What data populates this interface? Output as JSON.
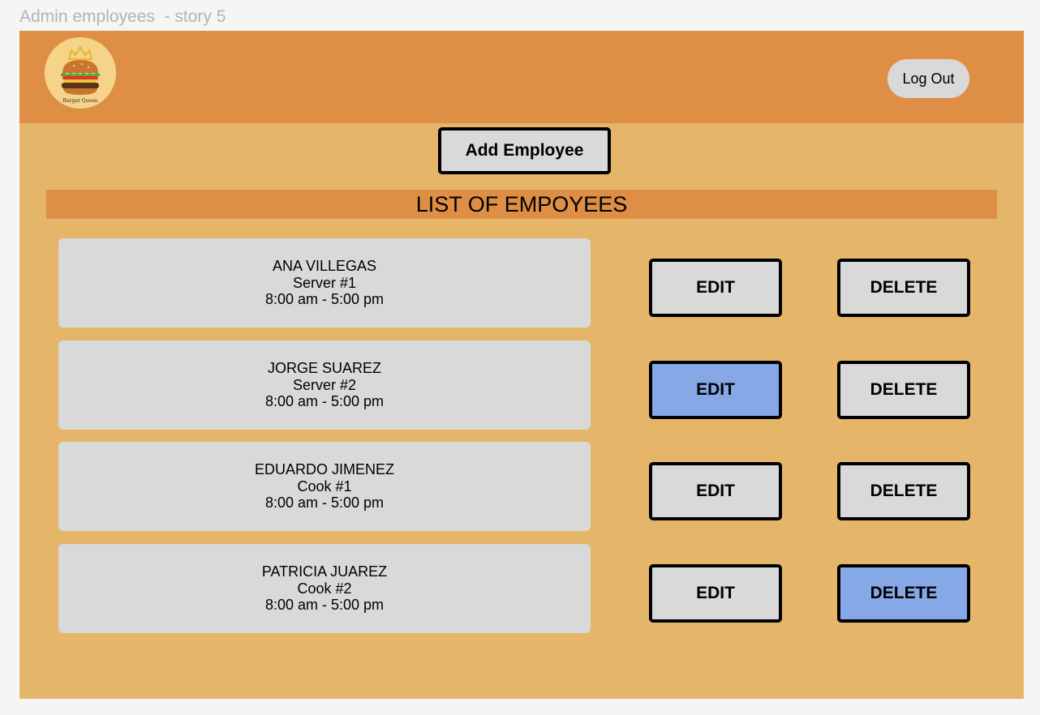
{
  "frame_label": "Admin employees  - story 5",
  "header": {
    "logo_text": "Burger Queen",
    "logout_label": "Log Out"
  },
  "add_employee_label": "Add Employee",
  "list_title": "LIST OF EMPOYEES",
  "colors": {
    "frame_background": "#e5b66a",
    "header_background": "#de8f45",
    "card_background": "#d9d9d9",
    "active_button": "#86a8e7"
  },
  "employees": [
    {
      "name": "ANA VILLEGAS",
      "role": "Server #1",
      "shift": "8:00 am - 5:00 pm",
      "edit_label": "EDIT",
      "delete_label": "DELETE",
      "highlighted": "none"
    },
    {
      "name": "JORGE SUAREZ",
      "role": "Server #2",
      "shift": "8:00 am - 5:00 pm",
      "edit_label": "EDIT",
      "delete_label": "DELETE",
      "highlighted": "edit"
    },
    {
      "name": "EDUARDO JIMENEZ",
      "role": "Cook #1",
      "shift": "8:00 am - 5:00 pm",
      "edit_label": "EDIT",
      "delete_label": "DELETE",
      "highlighted": "none"
    },
    {
      "name": "PATRICIA JUAREZ",
      "role": "Cook #2",
      "shift": "8:00 am - 5:00 pm",
      "edit_label": "EDIT",
      "delete_label": "DELETE",
      "highlighted": "delete"
    }
  ]
}
